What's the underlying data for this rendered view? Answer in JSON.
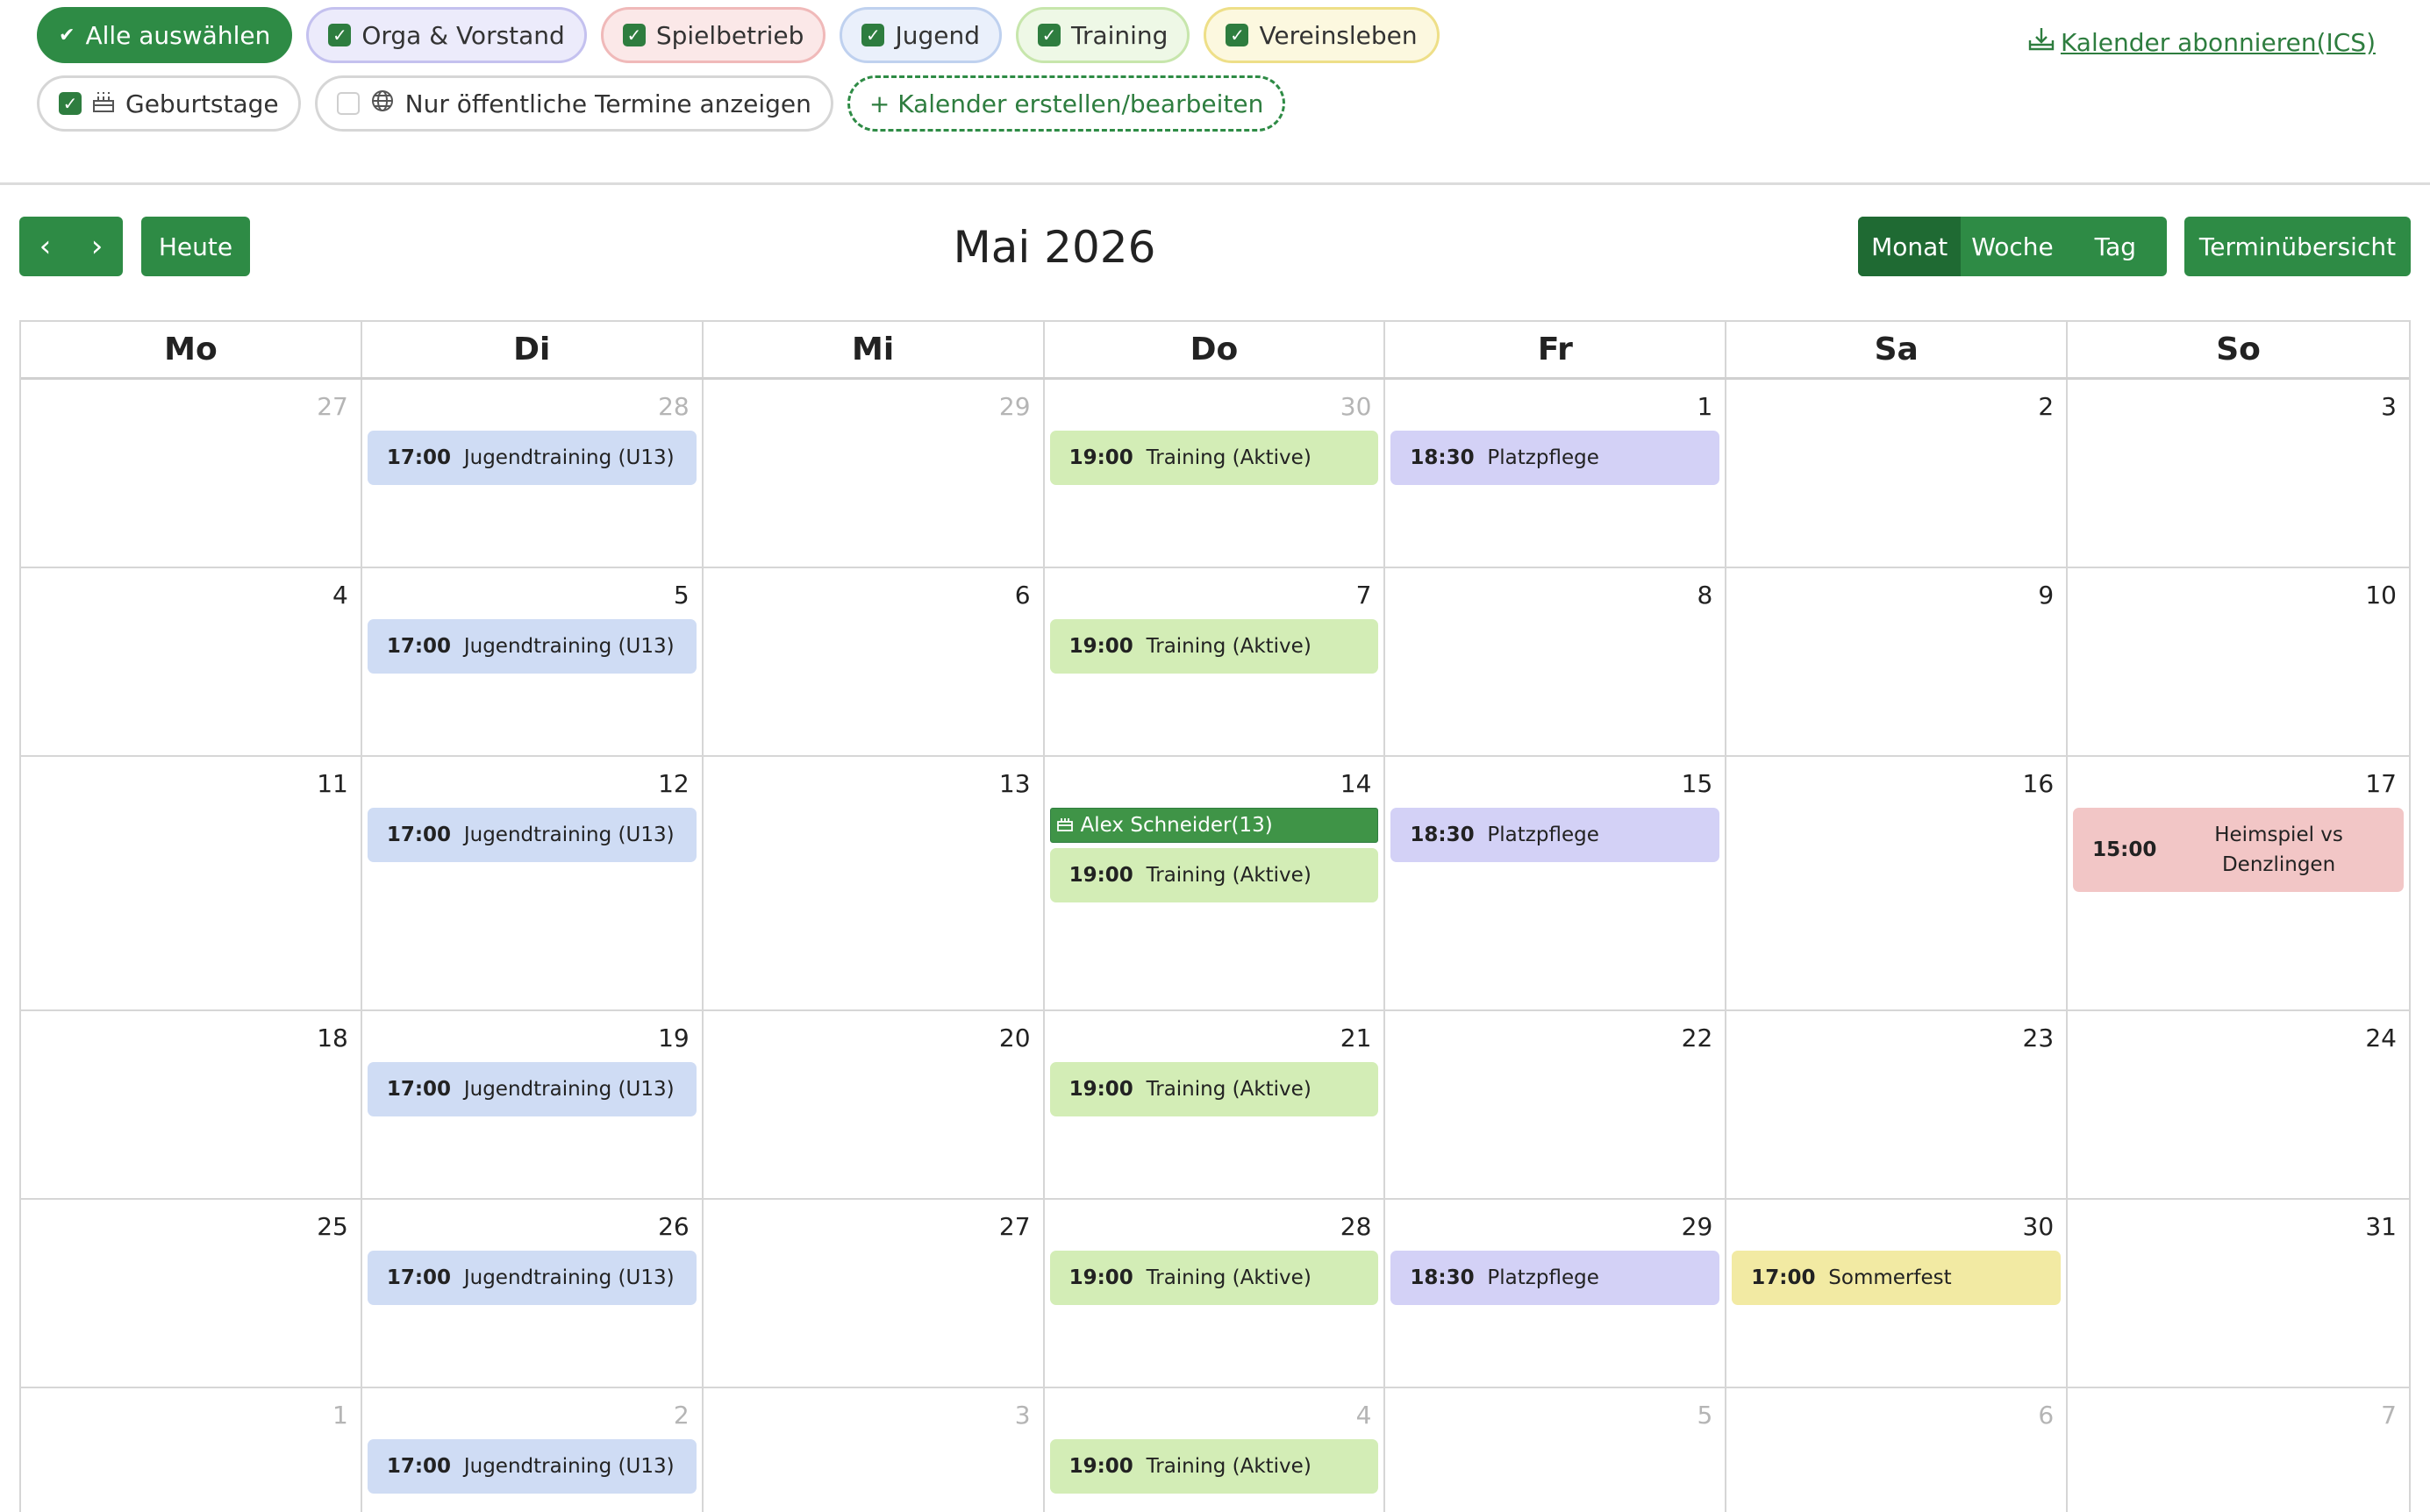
{
  "filters": {
    "row1": [
      {
        "id": "all",
        "label": "Alle auswählen",
        "checked": true
      },
      {
        "id": "orga",
        "label": "Orga & Vorstand",
        "checked": true
      },
      {
        "id": "spiel",
        "label": "Spielbetrieb",
        "checked": true
      },
      {
        "id": "jugend",
        "label": "Jugend",
        "checked": true
      },
      {
        "id": "training",
        "label": "Training",
        "checked": true
      },
      {
        "id": "verein",
        "label": "Vereinsleben",
        "checked": true
      }
    ],
    "row2": [
      {
        "id": "birthdays",
        "label": "Geburtstage",
        "checked": true,
        "icon": "cake-icon"
      },
      {
        "id": "public",
        "label": "Nur öffentliche Termine anzeigen",
        "checked": false,
        "icon": "globe-icon"
      },
      {
        "id": "create",
        "label": "+ Kalender erstellen/bearbeiten"
      }
    ]
  },
  "subscribe": {
    "label": "Kalender abonnieren(ICS)",
    "icon": "download-tray-icon"
  },
  "toolbar": {
    "prev": "‹",
    "next": "›",
    "today": "Heute",
    "title": "Mai 2026",
    "views": [
      "Monat",
      "Woche",
      "Tag"
    ],
    "active_view": "Monat",
    "overview": "Terminübersicht"
  },
  "weekdays": [
    "Mo",
    "Di",
    "Mi",
    "Do",
    "Fr",
    "Sa",
    "So"
  ],
  "colors": {
    "accent": "#2e8b45",
    "jugend": "#cfdcf4",
    "training": "#d3edb6",
    "orga": "#d3d1f6",
    "spiel": "#f2c6c6",
    "verein": "#f2eaa3",
    "birthday": "#3f9447"
  },
  "weeks": [
    [
      {
        "n": "27",
        "other": true,
        "events": []
      },
      {
        "n": "28",
        "other": true,
        "events": [
          {
            "time": "17:00",
            "title": "Jugendtraining (U13)",
            "cat": "jugend"
          }
        ]
      },
      {
        "n": "29",
        "other": true,
        "events": []
      },
      {
        "n": "30",
        "other": true,
        "events": [
          {
            "time": "19:00",
            "title": "Training (Aktive)",
            "cat": "training"
          }
        ]
      },
      {
        "n": "1",
        "events": [
          {
            "time": "18:30",
            "title": "Platzpflege",
            "cat": "orga"
          }
        ]
      },
      {
        "n": "2",
        "events": []
      },
      {
        "n": "3",
        "events": []
      }
    ],
    [
      {
        "n": "4",
        "events": []
      },
      {
        "n": "5",
        "events": [
          {
            "time": "17:00",
            "title": "Jugendtraining (U13)",
            "cat": "jugend"
          }
        ]
      },
      {
        "n": "6",
        "events": []
      },
      {
        "n": "7",
        "events": [
          {
            "time": "19:00",
            "title": "Training (Aktive)",
            "cat": "training"
          }
        ]
      },
      {
        "n": "8",
        "events": []
      },
      {
        "n": "9",
        "events": []
      },
      {
        "n": "10",
        "events": []
      }
    ],
    [
      {
        "n": "11",
        "events": []
      },
      {
        "n": "12",
        "events": [
          {
            "time": "17:00",
            "title": "Jugendtraining (U13)",
            "cat": "jugend"
          }
        ]
      },
      {
        "n": "13",
        "events": []
      },
      {
        "n": "14",
        "events": [
          {
            "birthday": "Alex Schneider(13)"
          },
          {
            "time": "19:00",
            "title": "Training (Aktive)",
            "cat": "training"
          }
        ]
      },
      {
        "n": "15",
        "events": [
          {
            "time": "18:30",
            "title": "Platzpflege",
            "cat": "orga"
          }
        ]
      },
      {
        "n": "16",
        "events": []
      },
      {
        "n": "17",
        "events": [
          {
            "time": "15:00",
            "title": "Heimspiel vs Denzlingen",
            "cat": "spiel",
            "wrap": true
          }
        ]
      }
    ],
    [
      {
        "n": "18",
        "events": []
      },
      {
        "n": "19",
        "events": [
          {
            "time": "17:00",
            "title": "Jugendtraining (U13)",
            "cat": "jugend"
          }
        ]
      },
      {
        "n": "20",
        "events": []
      },
      {
        "n": "21",
        "events": [
          {
            "time": "19:00",
            "title": "Training (Aktive)",
            "cat": "training"
          }
        ]
      },
      {
        "n": "22",
        "events": []
      },
      {
        "n": "23",
        "events": []
      },
      {
        "n": "24",
        "events": []
      }
    ],
    [
      {
        "n": "25",
        "events": []
      },
      {
        "n": "26",
        "events": [
          {
            "time": "17:00",
            "title": "Jugendtraining (U13)",
            "cat": "jugend"
          }
        ]
      },
      {
        "n": "27",
        "events": []
      },
      {
        "n": "28",
        "events": [
          {
            "time": "19:00",
            "title": "Training (Aktive)",
            "cat": "training"
          }
        ]
      },
      {
        "n": "29",
        "events": [
          {
            "time": "18:30",
            "title": "Platzpflege",
            "cat": "orga"
          }
        ]
      },
      {
        "n": "30",
        "events": [
          {
            "time": "17:00",
            "title": "Sommerfest",
            "cat": "verein"
          }
        ]
      },
      {
        "n": "31",
        "events": []
      }
    ],
    [
      {
        "n": "1",
        "other": true,
        "events": []
      },
      {
        "n": "2",
        "other": true,
        "events": [
          {
            "time": "17:00",
            "title": "Jugendtraining (U13)",
            "cat": "jugend"
          }
        ]
      },
      {
        "n": "3",
        "other": true,
        "events": []
      },
      {
        "n": "4",
        "other": true,
        "events": [
          {
            "time": "19:00",
            "title": "Training (Aktive)",
            "cat": "training"
          }
        ]
      },
      {
        "n": "5",
        "other": true,
        "events": []
      },
      {
        "n": "6",
        "other": true,
        "events": []
      },
      {
        "n": "7",
        "other": true,
        "events": []
      }
    ]
  ]
}
